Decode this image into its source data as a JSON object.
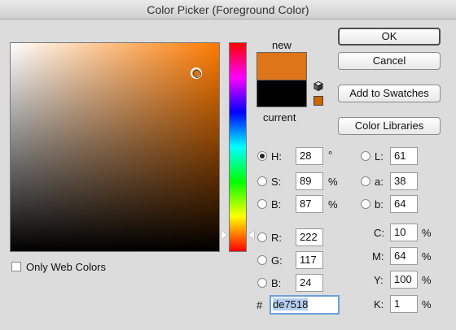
{
  "window": {
    "title": "Color Picker (Foreground Color)"
  },
  "swatches": {
    "new_label": "new",
    "current_label": "current",
    "new_color": "#de7518",
    "current_color": "#000000"
  },
  "buttons": {
    "ok": "OK",
    "cancel": "Cancel",
    "add_to_swatches": "Add to Swatches",
    "color_libraries": "Color Libraries"
  },
  "hsb": {
    "h": {
      "label": "H:",
      "value": "28",
      "unit": "°",
      "selected": true
    },
    "s": {
      "label": "S:",
      "value": "89",
      "unit": "%",
      "selected": false
    },
    "b": {
      "label": "B:",
      "value": "87",
      "unit": "%",
      "selected": false
    }
  },
  "rgb": {
    "r": {
      "label": "R:",
      "value": "222"
    },
    "g": {
      "label": "G:",
      "value": "117"
    },
    "b": {
      "label": "B:",
      "value": "24"
    }
  },
  "lab": {
    "l": {
      "label": "L:",
      "value": "61"
    },
    "a": {
      "label": "a:",
      "value": "38"
    },
    "b": {
      "label": "b:",
      "value": "64"
    }
  },
  "cmyk": {
    "c": {
      "label": "C:",
      "value": "10",
      "unit": "%"
    },
    "m": {
      "label": "M:",
      "value": "64",
      "unit": "%"
    },
    "y": {
      "label": "Y:",
      "value": "100",
      "unit": "%"
    },
    "k": {
      "label": "K:",
      "value": "1",
      "unit": "%"
    }
  },
  "hex": {
    "label": "#",
    "value": "de7518"
  },
  "only_web_colors": {
    "label": "Only Web Colors",
    "checked": false
  },
  "icons": {
    "gamut_warning": "cube-icon",
    "web_safe_swatch": "swatch-icon",
    "web_safe_color": "#cc6600"
  },
  "colors": {
    "accent_focus": "#6aa0e0",
    "selection": "#b5d0f2"
  }
}
